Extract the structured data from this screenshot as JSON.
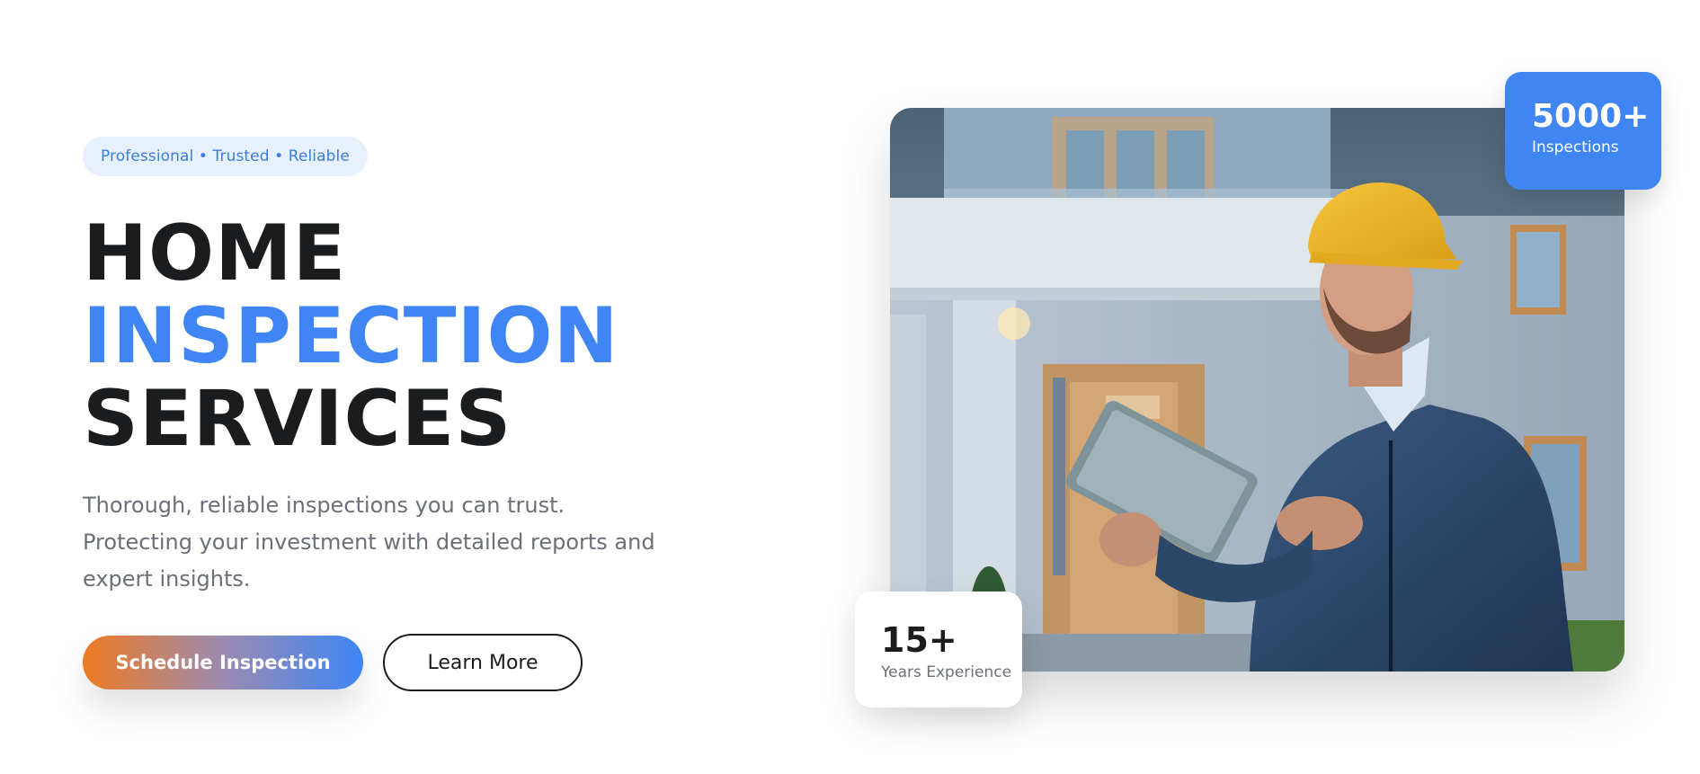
{
  "hero": {
    "badge": "Professional • Trusted • Reliable",
    "headline": {
      "line1": "HOME",
      "line2": "INSPECTION",
      "line3": "SERVICES"
    },
    "subtext": "Thorough, reliable inspections you can trust. Protecting your investment with detailed reports and expert insights.",
    "primary_button": "Schedule Inspection",
    "secondary_button": "Learn More"
  },
  "stats": {
    "inspections": {
      "value": "5000+",
      "label": "Inspections"
    },
    "experience": {
      "value": "15+",
      "label": "Years Experience"
    }
  },
  "image": {
    "subject": "home-inspector-photo"
  },
  "colors": {
    "accent_blue": "#3f85f3",
    "accent_orange": "#ef7a22",
    "text_dark": "#1b1c1e",
    "text_muted": "#6b6f78",
    "badge_bg": "#e7f0fd"
  }
}
